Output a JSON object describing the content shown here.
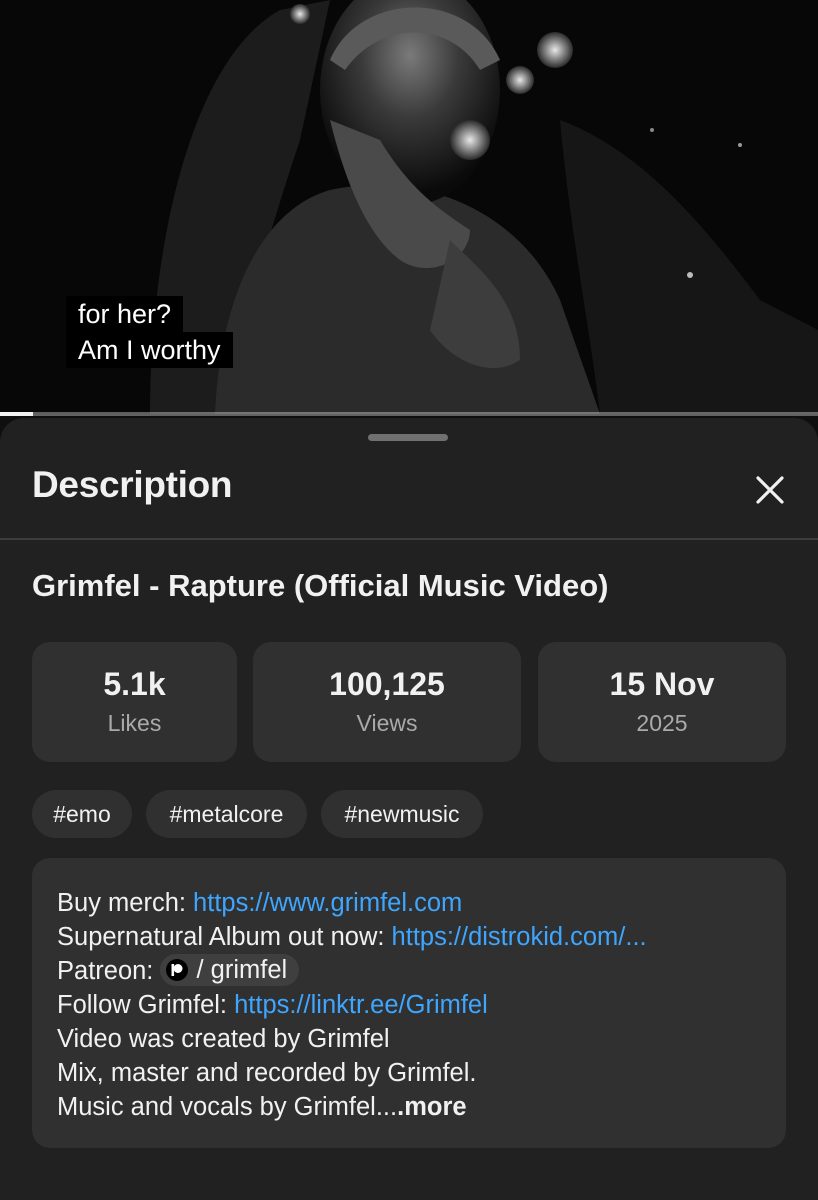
{
  "video": {
    "captions": [
      "for her?",
      "Am I worthy"
    ],
    "progress_fraction": 0.04
  },
  "sheet": {
    "title": "Description",
    "close_icon": "close-icon",
    "video_title": "Grimfel - Rapture (Official Music Video)",
    "stats": [
      {
        "value": "5.1k",
        "label": "Likes"
      },
      {
        "value": "100,125",
        "label": "Views"
      },
      {
        "value": "15 Nov",
        "label": "2025"
      }
    ],
    "tags": [
      "#emo",
      "#metalcore",
      "#newmusic"
    ],
    "description": {
      "merch_label": "Buy merch: ",
      "merch_link": "https://www.grimfel.com",
      "album_label": "Supernatural Album out now: ",
      "album_link": "https://distrokid.com/...",
      "patreon_label": "Patreon: ",
      "patreon_chip": "/ grimfel",
      "patreon_icon": "patreon-icon",
      "follow_label": "Follow Grimfel: ",
      "follow_link": "https://linktr.ee/Grimfel",
      "line5": "Video was created by Grimfel",
      "line6": "Mix, master and recorded by Grimfel.",
      "line7": "Music and vocals by Grimfel...",
      "more": ".more"
    }
  },
  "colors": {
    "background": "#0f0f0f",
    "sheet": "#212121",
    "card": "#303030",
    "link": "#3ea6ff",
    "muted_text": "#aaaaaa"
  }
}
